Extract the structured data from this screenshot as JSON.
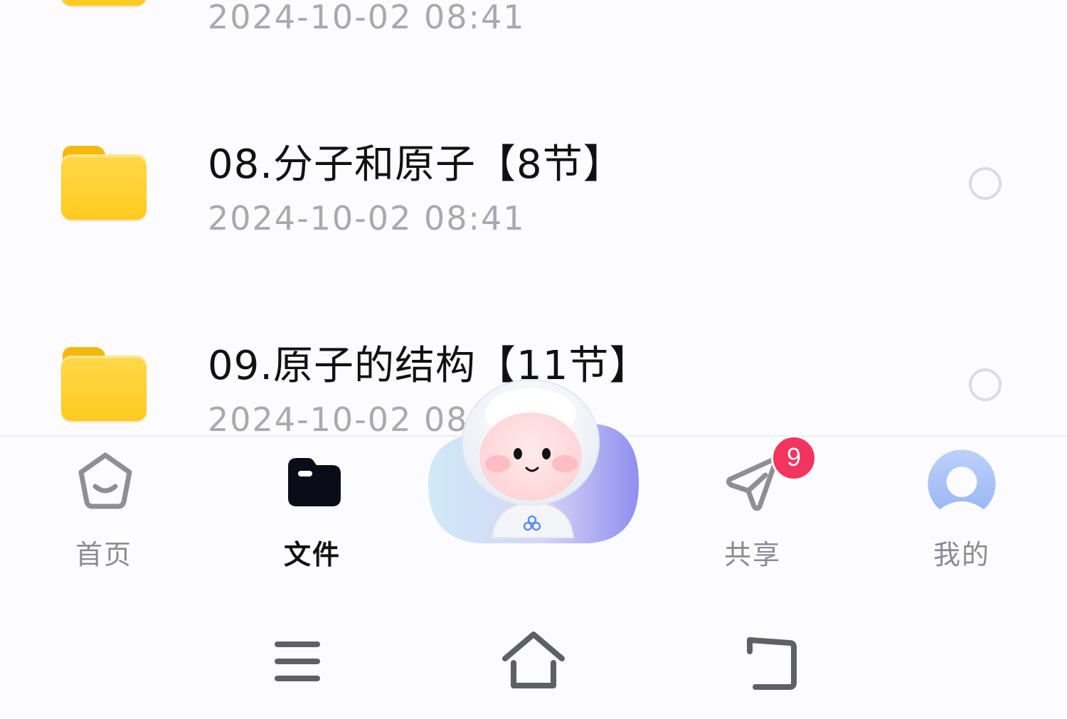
{
  "files": [
    {
      "name": "",
      "date": "2024-10-02  08:41"
    },
    {
      "name": "08.分子和原子【8节】",
      "date": "2024-10-02  08:41"
    },
    {
      "name": "09.原子的结构【11节】",
      "date": "2024-10-02  08:41"
    }
  ],
  "tabbar": {
    "home_label": "首页",
    "files_label": "文件",
    "share_label": "共享",
    "share_badge": "9",
    "mine_label": "我的"
  },
  "colors": {
    "folder": "#ffcf2e",
    "badge": "#f2345e",
    "active_tab": "#111111",
    "inactive_tab": "#8a8a90",
    "avatar": "#a9c3f7"
  },
  "icons": {
    "home": "home-icon",
    "files": "folder-icon",
    "share": "paper-plane-icon",
    "mine": "avatar-icon",
    "assistant": "mascot-icon",
    "menu": "menu-icon",
    "system_home": "system-home-icon",
    "back": "back-icon"
  }
}
